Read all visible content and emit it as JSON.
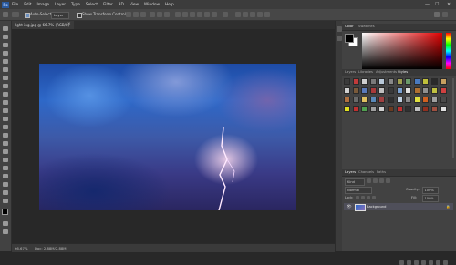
{
  "app": {
    "logo": "Ps"
  },
  "menubar": {
    "items": [
      "File",
      "Edit",
      "Image",
      "Layer",
      "Type",
      "Select",
      "Filter",
      "3D",
      "View",
      "Window",
      "Help"
    ]
  },
  "window_controls": {
    "minimize": "—",
    "maximize": "☐",
    "close": "✕"
  },
  "options_bar": {
    "auto_select_label": "Auto-Select:",
    "auto_select_value": "Layer",
    "show_transform_label": "Show Transform Controls",
    "auto_select_checked": true,
    "show_transform_checked": false
  },
  "document": {
    "tab_title": "light-ing.jpg @ 66.7% (RGB/8)",
    "close": "×"
  },
  "status_bar": {
    "zoom": "66.67%",
    "doc_info": "Doc: 2.88M/2.88M"
  },
  "color_panel": {
    "tabs": [
      {
        "label": "Color",
        "active": true
      },
      {
        "label": "Swatches",
        "active": false
      }
    ],
    "foreground": "#000000",
    "background": "#ffffff"
  },
  "styles_panel": {
    "tabs": [
      {
        "label": "Layers",
        "active": false
      },
      {
        "label": "Libraries",
        "active": false
      },
      {
        "label": "Adjustments",
        "active": false
      },
      {
        "label": "Styles",
        "active": true
      }
    ],
    "swatches": [
      "#3b3b3b",
      "#c23b3b",
      "#cfcfcf",
      "#7a7a7a",
      "#b8c8d8",
      "#888888",
      "#a0a050",
      "#6a9a6a",
      "#4a7abf",
      "#bfbf3a",
      "#2a2a2a",
      "#c8a060",
      "#d0d0d0",
      "#7a5a3a",
      "#5a7aba",
      "#a83a3a",
      "#c0c0c0",
      "#3a3a3a",
      "#7aa0d0",
      "#e0e0e0",
      "#b07030",
      "#909090",
      "#c0c040",
      "#d04040",
      "#b07040",
      "#6a6a6a",
      "#e0c060",
      "#5a8aba",
      "#a04040",
      "#303030",
      "#c0d0e0",
      "#8a8a8a",
      "#e0e040",
      "#d06020",
      "#a0a0a0",
      "#4a4a4a",
      "#e0e020",
      "#c03030",
      "#50a050",
      "#a0a0a0",
      "#d0d0d0",
      "#6a3a20",
      "#c03030",
      "#303030",
      "#c0c0c0",
      "#903020",
      "#a05040",
      "#e0e0e0"
    ]
  },
  "layers_panel": {
    "tabs": [
      {
        "label": "Layers",
        "active": true
      },
      {
        "label": "Channels",
        "active": false
      },
      {
        "label": "Paths",
        "active": false
      }
    ],
    "filter_label": "Kind",
    "blend_mode": "Normal",
    "opacity_label": "Opacity:",
    "opacity_value": "100%",
    "lock_label": "Lock:",
    "fill_label": "Fill:",
    "fill_value": "100%",
    "layers": [
      {
        "name": "Background",
        "visible": true,
        "locked": true
      }
    ]
  }
}
